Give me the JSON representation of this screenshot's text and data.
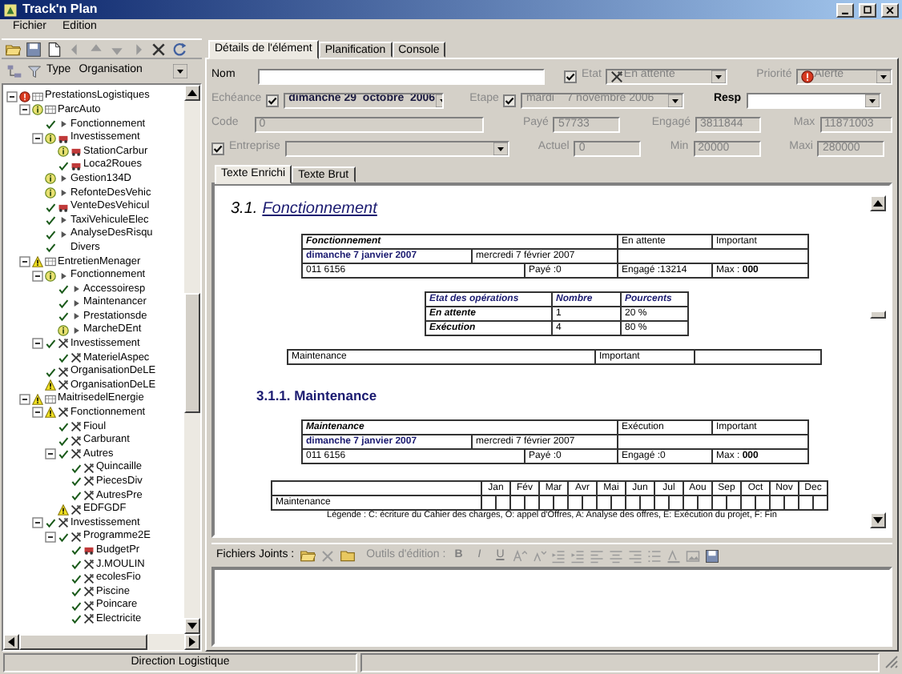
{
  "window": {
    "title": "Track'n Plan"
  },
  "menu": [
    "Fichier",
    "Edition"
  ],
  "type_filter": {
    "label": "Type",
    "value": "Organisation"
  },
  "tree": [
    {
      "label": "PrestationsLogistiques",
      "kind": "alert",
      "symbol": {
        "kind": "org"
      },
      "expanded": true,
      "children": [
        {
          "label": "ParcAuto",
          "kind": "info",
          "symbol": {
            "kind": "org"
          },
          "expanded": true,
          "children": [
            {
              "label": "Fonctionnement",
              "kind": "check",
              "symbol": {
                "kind": "task"
              }
            },
            {
              "label": "Investissement",
              "kind": "info",
              "symbol": {
                "kind": "vehicle"
              },
              "expanded": true,
              "children": [
                {
                  "label": "StationCarbur",
                  "kind": "info",
                  "symbol": {
                    "kind": "vehicle"
                  }
                },
                {
                  "label": "Loca2Roues",
                  "kind": "check",
                  "symbol": {
                    "kind": "vehicle"
                  }
                }
              ]
            },
            {
              "label": "Gestion134D",
              "kind": "info",
              "symbol": {
                "kind": "task"
              }
            },
            {
              "label": "RefonteDesVehic",
              "kind": "info",
              "symbol": {
                "kind": "task"
              }
            },
            {
              "label": "VenteDesVehicul",
              "kind": "check",
              "symbol": {
                "kind": "vehicle"
              }
            },
            {
              "label": "TaxiVehiculeElec",
              "kind": "check",
              "symbol": {
                "kind": "task"
              }
            },
            {
              "label": "AnalyseDesRisqu",
              "kind": "check",
              "symbol": {
                "kind": "task"
              }
            },
            {
              "label": "Divers",
              "kind": "check"
            }
          ]
        },
        {
          "label": "EntretienMenager",
          "kind": "warning",
          "symbol": {
            "kind": "org"
          },
          "expanded": true,
          "children": [
            {
              "label": "Fonctionnement",
              "kind": "info",
              "symbol": {
                "kind": "task"
              },
              "expanded": true,
              "children": [
                {
                  "label": "Accessoiresp",
                  "kind": "check",
                  "symbol": {
                    "kind": "task"
                  }
                },
                {
                  "label": "Maintenancer",
                  "kind": "check",
                  "symbol": {
                    "kind": "task"
                  }
                },
                {
                  "label": "Prestationsde",
                  "kind": "check",
                  "symbol": {
                    "kind": "task"
                  }
                },
                {
                  "label": "MarcheDEnt",
                  "kind": "info",
                  "symbol": {
                    "kind": "task"
                  }
                }
              ]
            },
            {
              "label": "Investissement",
              "kind": "check",
              "symbol": {
                "kind": "tools"
              },
              "expanded": true,
              "children": [
                {
                  "label": "MaterielAspec",
                  "kind": "check",
                  "symbol": {
                    "kind": "tools"
                  }
                }
              ]
            },
            {
              "label": "OrganisationDeLE",
              "kind": "check",
              "symbol": {
                "kind": "tools"
              }
            },
            {
              "label": "OrganisationDeLE",
              "kind": "warning",
              "symbol": {
                "kind": "tools"
              }
            }
          ]
        },
        {
          "label": "MaitrisedelEnergie",
          "kind": "warning",
          "symbol": {
            "kind": "org"
          },
          "expanded": true,
          "children": [
            {
              "label": "Fonctionnement",
              "kind": "warning",
              "symbol": {
                "kind": "tools"
              },
              "expanded": true,
              "children": [
                {
                  "label": "Fioul",
                  "kind": "check",
                  "symbol": {
                    "kind": "tools"
                  }
                },
                {
                  "label": "Carburant",
                  "kind": "check",
                  "symbol": {
                    "kind": "tools"
                  }
                },
                {
                  "label": "Autres",
                  "kind": "check",
                  "symbol": {
                    "kind": "tools"
                  },
                  "expanded": true,
                  "children": [
                    {
                      "label": "Quincaille",
                      "kind": "check",
                      "symbol": {
                        "kind": "tools"
                      }
                    },
                    {
                      "label": "PiecesDiv",
                      "kind": "check",
                      "symbol": {
                        "kind": "tools"
                      }
                    },
                    {
                      "label": "AutresPre",
                      "kind": "check",
                      "symbol": {
                        "kind": "tools"
                      }
                    }
                  ]
                },
                {
                  "label": "EDFGDF",
                  "kind": "warning",
                  "symbol": {
                    "kind": "tools"
                  }
                }
              ]
            },
            {
              "label": "Investissement",
              "kind": "check",
              "symbol": {
                "kind": "tools"
              },
              "expanded": true,
              "children": [
                {
                  "label": "Programme2E",
                  "kind": "check",
                  "symbol": {
                    "kind": "tools"
                  },
                  "expanded": true,
                  "children": [
                    {
                      "label": "BudgetPr",
                      "kind": "check",
                      "symbol": {
                        "kind": "vehicle"
                      }
                    },
                    {
                      "label": "J.MOULIN",
                      "kind": "check",
                      "symbol": {
                        "kind": "tools"
                      }
                    },
                    {
                      "label": "ecolesFio",
                      "kind": "check",
                      "symbol": {
                        "kind": "tools"
                      }
                    },
                    {
                      "label": "Piscine",
                      "kind": "check",
                      "symbol": {
                        "kind": "tools"
                      }
                    },
                    {
                      "label": "Poincare",
                      "kind": "check",
                      "symbol": {
                        "kind": "tools"
                      }
                    },
                    {
                      "label": "Electricite",
                      "kind": "check",
                      "symbol": {
                        "kind": "tools"
                      }
                    }
                  ]
                }
              ]
            }
          ]
        }
      ]
    }
  ],
  "tabs": [
    {
      "label": "Détails de l'élément",
      "selected": true
    },
    {
      "label": "Planification",
      "selected": false
    },
    {
      "label": "Console",
      "selected": false
    }
  ],
  "form": {
    "nom": {
      "label": "Nom",
      "disabled": false
    },
    "etat": {
      "label": "Etat",
      "checked": true,
      "value": "En attente",
      "disabled": true
    },
    "priorite": {
      "label": "Priorité",
      "value": "Alerte",
      "disabled": true
    },
    "echeance": {
      "label": "Echéance",
      "checked": true,
      "value": "dimanche 29  octobre  2006",
      "disabled": true
    },
    "etape": {
      "label": "Etape",
      "checked": true,
      "value": "mardi    7 novembre 2006",
      "disabled": true
    },
    "resp": {
      "label": "Resp",
      "disabled": false
    },
    "code": {
      "label": "Code",
      "value": "0",
      "disabled": true
    },
    "paye": {
      "label": "Payé",
      "value": "57733",
      "disabled": true
    },
    "engage": {
      "label": "Engagé",
      "value": "3811844",
      "disabled": true
    },
    "max": {
      "label": "Max",
      "value": "11871003",
      "disabled": true
    },
    "entreprise": {
      "label": "Entreprise",
      "checked": true,
      "disabled": true
    },
    "actuel": {
      "label": "Actuel",
      "value": "0",
      "disabled": true
    },
    "min": {
      "label": "Min",
      "value": "20000",
      "disabled": true
    },
    "maxi": {
      "label": "Maxi",
      "value": "280000",
      "disabled": true
    }
  },
  "editor_tabs": [
    {
      "label": "Texte Enrichi",
      "selected": true
    },
    {
      "label": "Texte Brut",
      "selected": false
    }
  ],
  "document": [
    {
      "kind": "heading1",
      "number": "3.1.",
      "title": "Fonctionnement"
    },
    {
      "kind": "task_table",
      "name": "Fonctionnement",
      "status": "En attente",
      "priority": "Important",
      "start": "dimanche 7 janvier 2007",
      "end": "mercredi 7 février 2007",
      "code": "011 6156",
      "paid": "Payé :0",
      "engaged": "Engagé :13214",
      "max_label": "Max :",
      "max_value": "000"
    },
    {
      "kind": "ops_table",
      "columns": [
        "Etat des opérations",
        "Nombre",
        "Pourcents"
      ],
      "rows": [
        [
          "En attente",
          "1",
          "20 %"
        ],
        [
          "Exécution",
          "4",
          "80 %"
        ]
      ]
    },
    {
      "kind": "item_row",
      "cells": [
        "Maintenance",
        "Important"
      ]
    },
    {
      "kind": "heading2",
      "text": "3.1.1. Maintenance"
    },
    {
      "kind": "task_table",
      "name": "Maintenance",
      "status": "Exécution",
      "priority": "Important",
      "start": "dimanche 7 janvier 2007",
      "end": "mercredi 7 février 2007",
      "code": "011 6156",
      "paid": "Payé :0",
      "engaged": "Engagé :0",
      "max_label": "Max :",
      "max_value": "000"
    },
    {
      "kind": "gantt",
      "months": [
        "Jan",
        "Fév",
        "Mar",
        "Avr",
        "Mai",
        "Jun",
        "Jul",
        "Aou",
        "Sep",
        "Oct",
        "Nov",
        "Dec"
      ],
      "rows": [
        "Maintenance"
      ],
      "legend": "Légende : C: écriture du Cahier des charges, O: appel d'Offres, A: Analyse des offres, E: Exécution du projet, F: Fin"
    }
  ],
  "attachments": {
    "label": "Fichiers Joints :",
    "tools_label": "Outils d'édition :",
    "format_buttons": [
      "B",
      "I",
      "U"
    ]
  },
  "status_bar": [
    "Direction Logistique"
  ]
}
